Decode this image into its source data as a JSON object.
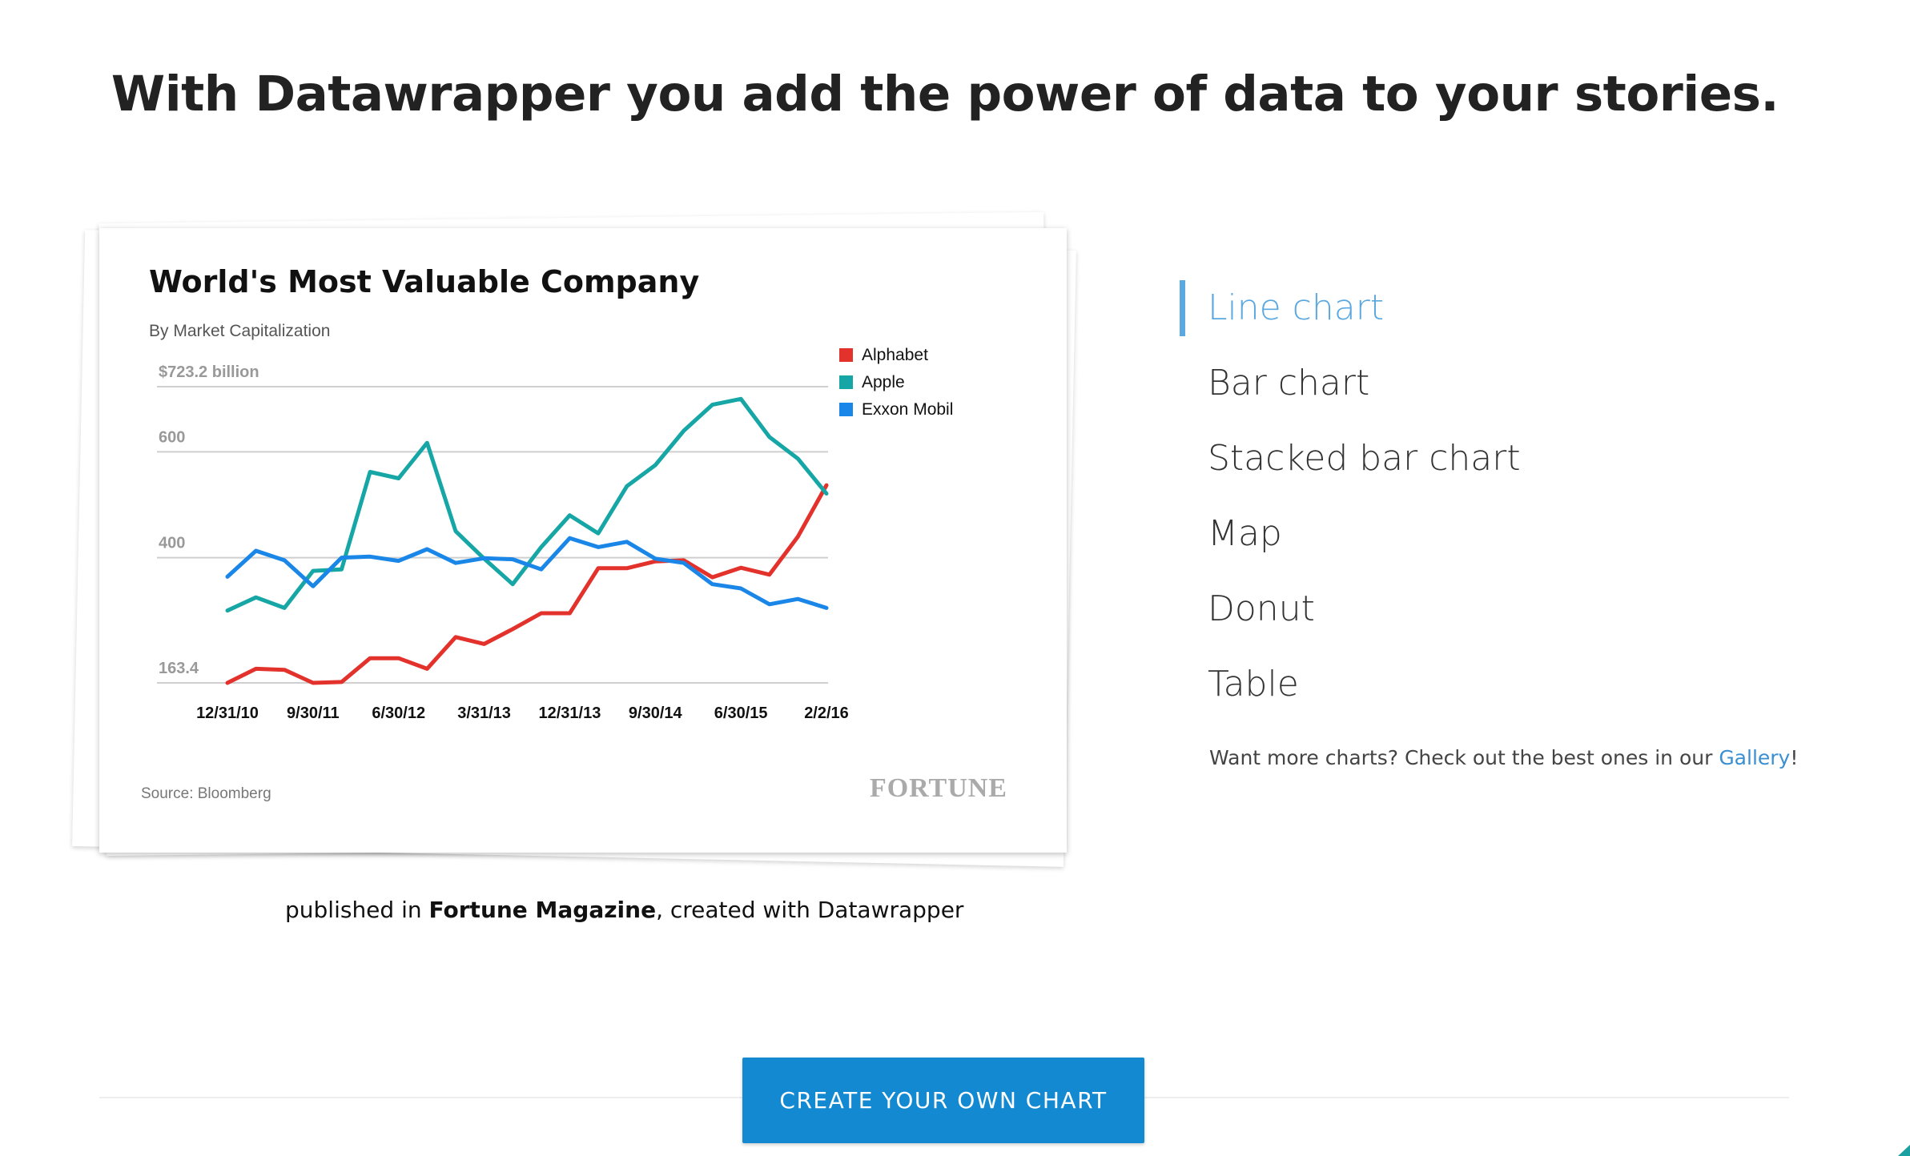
{
  "page": {
    "headline": "With Datawrapper you add the power of data to your stories."
  },
  "example": {
    "caption_pre": "published in ",
    "caption_bold": "Fortune Magazine",
    "caption_post": ", created with Datawrapper",
    "logo_text": "FORTUNE",
    "source": "Source: Bloomberg"
  },
  "chart_types": [
    {
      "label": "Line chart",
      "active": true
    },
    {
      "label": "Bar chart",
      "active": false
    },
    {
      "label": "Stacked bar chart",
      "active": false
    },
    {
      "label": "Map",
      "active": false
    },
    {
      "label": "Donut",
      "active": false
    },
    {
      "label": "Table",
      "active": false
    }
  ],
  "more": {
    "text": "Want more charts? Check out the best ones in our ",
    "link_label": "Gallery",
    "suffix": "!"
  },
  "cta": {
    "label": "CREATE YOUR OWN CHART"
  },
  "colors": {
    "accent": "#5ba8e0",
    "button": "#1389d2",
    "link": "#3a8fd0"
  },
  "chart_data": {
    "type": "line",
    "title": "World's Most Valuable Company",
    "subtitle": "By Market Capitalization",
    "xlabel": "",
    "ylabel": "",
    "ylim": [
      163.4,
      723.2
    ],
    "y_ticks": [
      {
        "value": 723.2,
        "label": "$723.2 billion"
      },
      {
        "value": 600,
        "label": "600"
      },
      {
        "value": 400,
        "label": "400"
      },
      {
        "value": 163.4,
        "label": "163.4"
      }
    ],
    "x_tick_labels": [
      "12/31/10",
      "9/30/11",
      "6/30/12",
      "3/31/13",
      "12/31/13",
      "9/30/14",
      "6/30/15",
      "2/2/16"
    ],
    "x_tick_index": [
      0,
      3,
      6,
      9,
      12,
      15,
      18,
      21
    ],
    "grid": true,
    "legend_position": "top-right",
    "series": [
      {
        "name": "Alphabet",
        "color": "#e3312b",
        "values": [
          163.4,
          190,
          188,
          163.4,
          165,
          210,
          210,
          190,
          250,
          237,
          265,
          295,
          295,
          380,
          380,
          393,
          395,
          363,
          381,
          368,
          440,
          537
        ]
      },
      {
        "name": "Apple",
        "color": "#16a6a6",
        "values": [
          300,
          325,
          305,
          375,
          378,
          562,
          550,
          617,
          450,
          398,
          350,
          420,
          480,
          446,
          535,
          575,
          640,
          689,
          700,
          628,
          587,
          521
        ]
      },
      {
        "name": "Exxon Mobil",
        "color": "#1a87e8",
        "values": [
          364,
          413,
          395,
          346,
          400,
          402,
          394,
          416,
          390,
          399,
          397,
          378,
          437,
          420,
          430,
          398,
          390,
          350,
          342,
          312,
          322,
          305
        ]
      }
    ]
  }
}
